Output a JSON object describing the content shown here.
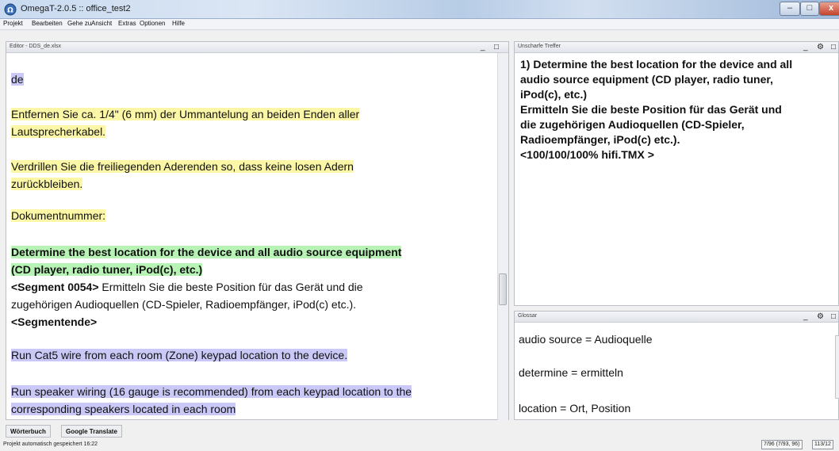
{
  "window": {
    "title": "OmegaT-2.0.5 :: office_test2",
    "controls": {
      "minimize": "–",
      "maximize": "□",
      "close": "x"
    }
  },
  "menu": [
    "Projekt",
    "Bearbeiten",
    "Gehe zu",
    "Ansicht",
    "Extras",
    "Optionen",
    "Hilfe"
  ],
  "editor": {
    "title": "Editor - DDS_de.xlsx",
    "segments": [
      "de",
      "Entfernen Sie ca. 1/4\" (6 mm) der Ummantelung an beiden Enden aller",
      "Lautsprecherkabel.",
      "Verdrillen Sie die freiliegenden Aderenden so, dass keine losen Adern",
      "zurückbleiben.",
      "Dokumentnummer:",
      "Determine the best location for the device and all audio source equipment",
      "(CD player, radio tuner, iPod(c), etc.)",
      "<Segment 0054>",
      " Ermitteln Sie die beste Position für das Gerät und die",
      "zugehörigen Audioquellen (CD-Spieler, Radioempfänger, iPod(c) etc.).",
      "<Segmentende>",
      "Run Cat5 wire from each room (Zone) keypad location to the device.",
      "Run speaker wiring (16 gauge is recommended) from each keypad location to the",
      "corresponding speakers located in each room"
    ]
  },
  "fuzzy": {
    "title": "Unscharfe Treffer",
    "lines": [
      "1) Determine the best location for the device and all",
      "audio source equipment (CD player, radio tuner,",
      "iPod(c), etc.)",
      "Ermitteln Sie die beste Position für das Gerät und",
      "die zugehörigen Audioquellen (CD-Spieler,",
      "Radioempfänger, iPod(c) etc.).",
      "<100/100/100% hifi.TMX >"
    ]
  },
  "glossary": {
    "title": "Glossar",
    "entries": [
      "audio source = Audioquelle",
      "determine = ermitteln",
      "location = Ort, Position"
    ]
  },
  "tabs": [
    "Wörterbuch",
    "Google Translate"
  ],
  "status": {
    "left": "Projekt automatisch gespeichert 16:22",
    "progress": "7/96 (7/93, 96)",
    "counter": "113/12"
  },
  "colors": {
    "highlight_purple": "#c9c8f6",
    "highlight_yellow": "#fcf7a6",
    "highlight_green": "#b8f3b6"
  }
}
